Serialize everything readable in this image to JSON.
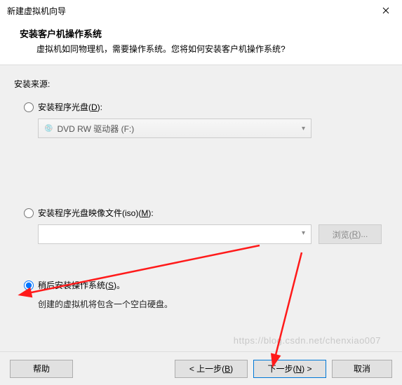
{
  "titlebar": {
    "title": "新建虚拟机向导"
  },
  "header": {
    "title": "安装客户机操作系统",
    "subtitle": "虚拟机如同物理机，需要操作系统。您将如何安装客户机操作系统?"
  },
  "source_label": "安装来源:",
  "options": {
    "disc": {
      "label_pre": "安装程序光盘(",
      "hotkey": "D",
      "label_post": "):",
      "drive_text": "DVD RW 驱动器 (F:)"
    },
    "iso": {
      "label_pre": "安装程序光盘映像文件(iso)(",
      "hotkey": "M",
      "label_post": "):",
      "browse_pre": "浏览(",
      "browse_hotkey": "R",
      "browse_post": ")..."
    },
    "later": {
      "label_pre": "稍后安装操作系统(",
      "hotkey": "S",
      "label_post": ")。",
      "desc": "创建的虚拟机将包含一个空白硬盘。"
    }
  },
  "footer": {
    "help": "帮助",
    "back_pre": "< 上一步(",
    "back_hotkey": "B",
    "back_post": ")",
    "next_pre": "下一步(",
    "next_hotkey": "N",
    "next_post": ") >",
    "cancel": "取消"
  },
  "watermark": "https://blog.csdn.net/chenxiao007"
}
